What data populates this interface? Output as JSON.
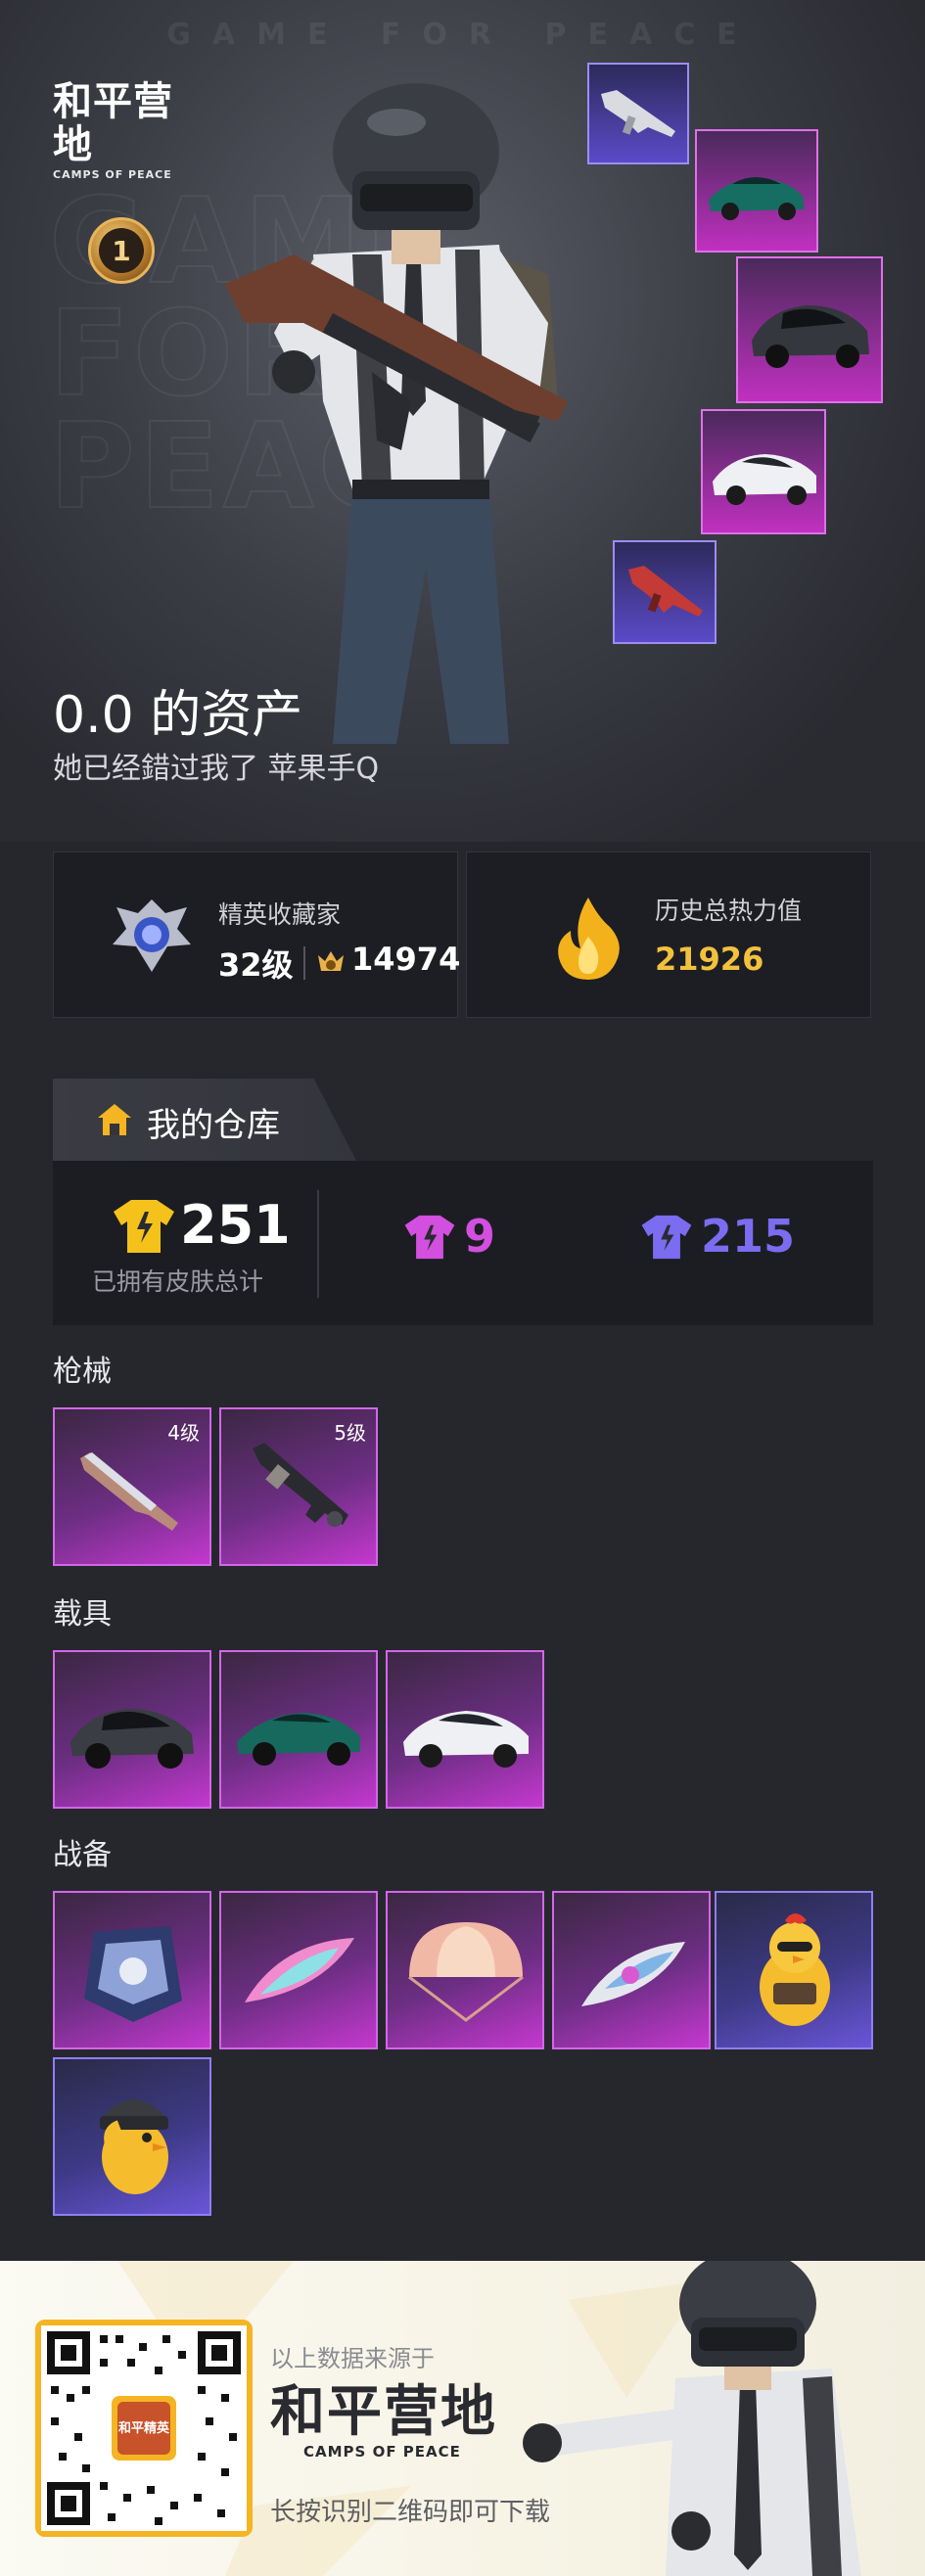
{
  "hero": {
    "bg_text": "GAME FOR PEACE",
    "bg_big": "GAME FOR PEACE",
    "logo_main": "和平营地",
    "logo_sub": "CAMPS OF PEACE",
    "rank_number": "1",
    "title": "0.0 的资产",
    "subtitle": "她已经錯过我了  苹果手Q"
  },
  "stats": {
    "collector": {
      "label": "精英收藏家",
      "level": "32级",
      "points": "14974",
      "icon": "collector-badge-icon"
    },
    "heat": {
      "label": "历史总热力值",
      "value": "21926",
      "icon": "flame-icon"
    }
  },
  "warehouse": {
    "title": "我的仓库",
    "total_value": "251",
    "total_label": "已拥有皮肤总计",
    "purple_count": "9",
    "blue_count": "215",
    "colors": {
      "gold": "#f5c21b",
      "purple": "#d24fe0",
      "blue": "#7b6cf0"
    }
  },
  "sections": {
    "guns": {
      "title": "枪械",
      "items": [
        {
          "level": "4级",
          "icon": "rifle-icon"
        },
        {
          "level": "5级",
          "icon": "machine-gun-icon"
        }
      ]
    },
    "vehicles": {
      "title": "载具",
      "items": [
        {
          "icon": "suv-icon"
        },
        {
          "icon": "sports-car-icon"
        },
        {
          "icon": "sedan-icon"
        }
      ]
    },
    "gear": {
      "title": "战备",
      "items": [
        {
          "icon": "backpack-icon"
        },
        {
          "icon": "glider-icon"
        },
        {
          "icon": "parachute-icon"
        },
        {
          "icon": "glider-icon"
        },
        {
          "icon": "chicken-icon"
        },
        {
          "icon": "chicken-helmet-icon"
        }
      ]
    }
  },
  "footer": {
    "line1": "以上数据来源于",
    "brand": "和平营地",
    "brand_sub": "CAMPS OF PEACE",
    "line2": "长按识别二维码即可下载",
    "qr_label": "和平精英"
  }
}
